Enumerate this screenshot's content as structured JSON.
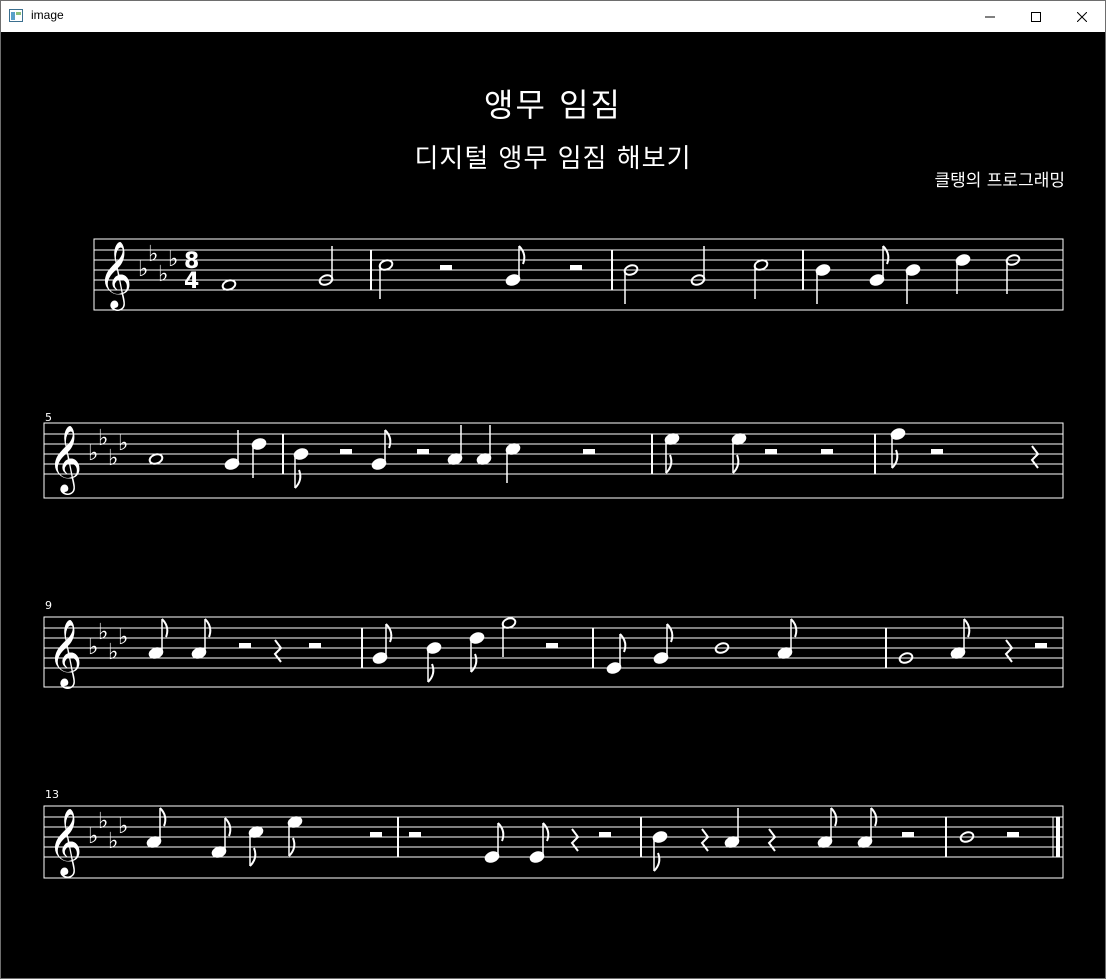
{
  "window": {
    "title": "image",
    "icon": "app-window-icon",
    "controls": [
      "minimize-icon",
      "maximize-icon",
      "close-icon"
    ]
  },
  "sheet": {
    "title": "앵무 임짐",
    "subtitle": "디지털 앵무 임짐 해보기",
    "composer": "클탱의 프로그래밍"
  },
  "score": {
    "clef": "treble",
    "key_signature": "A-flat major (4 flats)",
    "time_signature": "8/4",
    "systems": [
      {
        "measure_number": ""
      },
      {
        "measure_number": "5"
      },
      {
        "measure_number": "9"
      },
      {
        "measure_number": "13"
      }
    ]
  },
  "colors": {
    "background": "#000000",
    "ink": "#ffffff",
    "titlebar": "#ffffff"
  }
}
